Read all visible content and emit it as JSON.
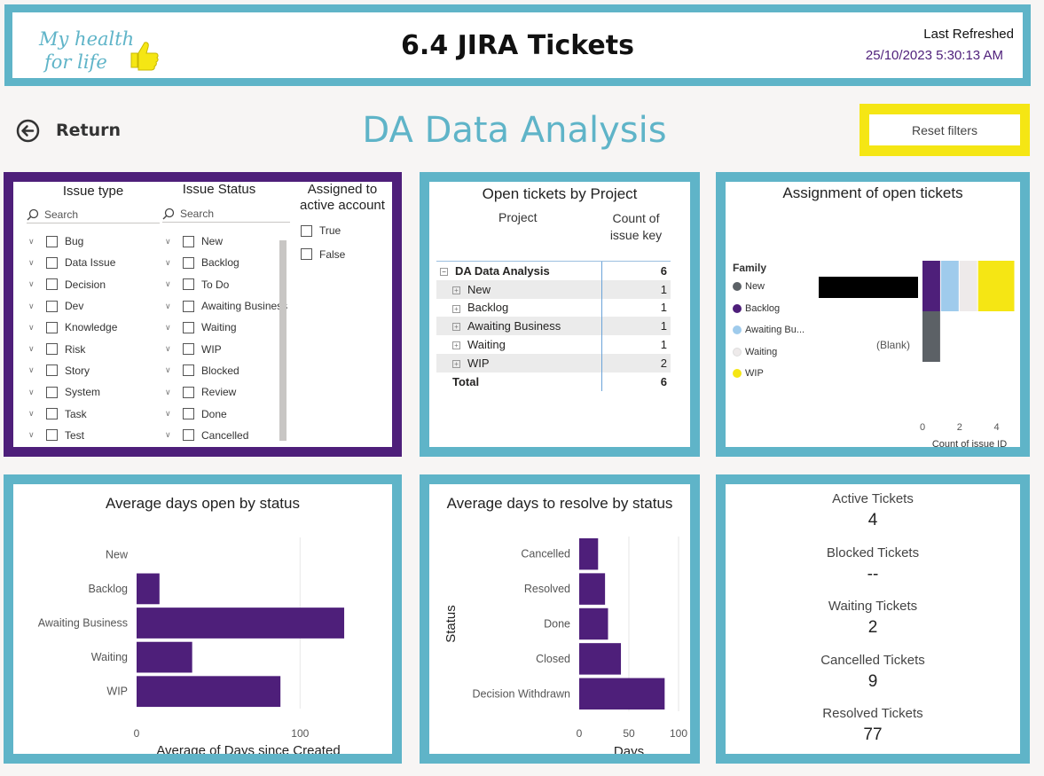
{
  "header": {
    "logo_line1": "My health",
    "logo_line2": "for life",
    "title": "6.4 JIRA Tickets",
    "refresh_label": "Last Refreshed",
    "refresh_value": "25/10/2023 5:30:13 AM"
  },
  "nav": {
    "return_label": "Return",
    "page_title": "DA Data Analysis",
    "reset_label": "Reset filters"
  },
  "slicers": {
    "issue_type": {
      "title": "Issue type",
      "search_placeholder": "Search",
      "items": [
        "Bug",
        "Data Issue",
        "Decision",
        "Dev",
        "Knowledge",
        "Risk",
        "Story",
        "System",
        "Task",
        "Test"
      ]
    },
    "issue_status": {
      "title": "Issue Status",
      "search_placeholder": "Search",
      "items": [
        "New",
        "Backlog",
        "To Do",
        "Awaiting Business",
        "Waiting",
        "WIP",
        "Blocked",
        "Review",
        "Done",
        "Cancelled"
      ]
    },
    "assigned": {
      "title_line1": "Assigned to",
      "title_line2": "active account",
      "items": [
        "True",
        "False"
      ]
    }
  },
  "matrix": {
    "title": "Open tickets by Project",
    "col_project": "Project",
    "col_count_line1": "Count of",
    "col_count_line2": "issue key",
    "group": {
      "label": "DA Data Analysis",
      "value": "6"
    },
    "rows": [
      {
        "label": "New",
        "value": "1"
      },
      {
        "label": "Backlog",
        "value": "1"
      },
      {
        "label": "Awaiting Business",
        "value": "1"
      },
      {
        "label": "Waiting",
        "value": "1"
      },
      {
        "label": "WIP",
        "value": "2"
      }
    ],
    "total": {
      "label": "Total",
      "value": "6"
    }
  },
  "assignment": {
    "title": "Assignment of open tickets",
    "legend_title": "Family",
    "legend": [
      {
        "label": "New",
        "color": "#5c6166"
      },
      {
        "label": "Backlog",
        "color": "#4e1f7a"
      },
      {
        "label": "Awaiting Bu...",
        "color": "#9fcbec"
      },
      {
        "label": "Waiting",
        "color": "#eeeaea"
      },
      {
        "label": "WIP",
        "color": "#f5e614"
      }
    ],
    "blank_label": "(Blank)",
    "x_axis_label": "Count of issue ID"
  },
  "kpis": [
    {
      "label": "Active Tickets",
      "value": "4"
    },
    {
      "label": "Blocked Tickets",
      "value": "--"
    },
    {
      "label": "Waiting Tickets",
      "value": "2"
    },
    {
      "label": "Cancelled Tickets",
      "value": "9"
    },
    {
      "label": "Resolved Tickets",
      "value": "77"
    }
  ],
  "chart_data": [
    {
      "type": "bar",
      "orientation": "horizontal",
      "stacked": true,
      "title": "Assignment of open tickets",
      "categories": [
        "",
        "(Blank)"
      ],
      "series": [
        {
          "name": "New",
          "values": [
            0,
            1
          ]
        },
        {
          "name": "Backlog",
          "values": [
            1,
            0
          ]
        },
        {
          "name": "Awaiting Bu...",
          "values": [
            1,
            0
          ]
        },
        {
          "name": "Waiting",
          "values": [
            1,
            0
          ]
        },
        {
          "name": "WIP",
          "values": [
            2,
            0
          ]
        }
      ],
      "xlabel": "Count of issue ID",
      "xticks": [
        0,
        2,
        4
      ],
      "xlim": [
        0,
        5
      ],
      "legend": "left"
    },
    {
      "type": "bar",
      "orientation": "horizontal",
      "title": "Average days open by status",
      "categories": [
        "New",
        "Backlog",
        "Awaiting Business",
        "Waiting",
        "WIP"
      ],
      "values": [
        0,
        14,
        127,
        34,
        88
      ],
      "xlabel": "Average of Days since Created",
      "xticks": [
        0,
        100
      ],
      "xlim": [
        0,
        140
      ],
      "grid": true,
      "color": "#4e1f7a"
    },
    {
      "type": "bar",
      "orientation": "horizontal",
      "title": "Average days to resolve by status",
      "categories": [
        "Cancelled",
        "Resolved",
        "Done",
        "Closed",
        "Decision Withdrawn"
      ],
      "values": [
        19,
        26,
        29,
        42,
        86
      ],
      "xlabel": "Days",
      "ylabel": "Status",
      "xticks": [
        0,
        50,
        100
      ],
      "xlim": [
        0,
        100
      ],
      "grid": true,
      "color": "#4e1f7a"
    }
  ]
}
